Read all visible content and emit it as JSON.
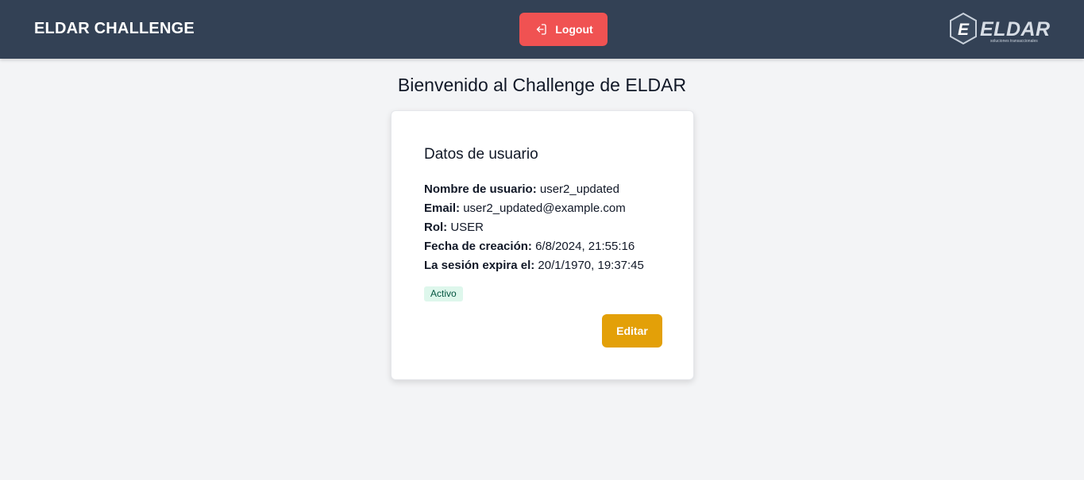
{
  "header": {
    "brand": "ELDAR CHALLENGE",
    "logout_label": "Logout",
    "logout_icon": "logout-icon",
    "logo": {
      "text": "ELDAR",
      "tagline": "soluciones transaccionales"
    },
    "colors": {
      "background": "#334155",
      "logout_button": "#f05252"
    }
  },
  "main": {
    "welcome": "Bienvenido al Challenge de ELDAR"
  },
  "user_card": {
    "title": "Datos de usuario",
    "fields": {
      "username": {
        "label": "Nombre de usuario:",
        "value": "user2_updated"
      },
      "email": {
        "label": "Email:",
        "value": "user2_updated@example.com"
      },
      "role": {
        "label": "Rol:",
        "value": "USER"
      },
      "created": {
        "label": "Fecha de creación:",
        "value": "6/8/2024, 21:55:16"
      },
      "expires": {
        "label": "La sesión expira el:",
        "value": "20/1/1970, 19:37:45"
      }
    },
    "status_badge": "Activo",
    "edit_label": "Editar",
    "colors": {
      "badge_bg": "#def7ec",
      "badge_text": "#03543f",
      "edit_button": "#e3a008"
    }
  }
}
